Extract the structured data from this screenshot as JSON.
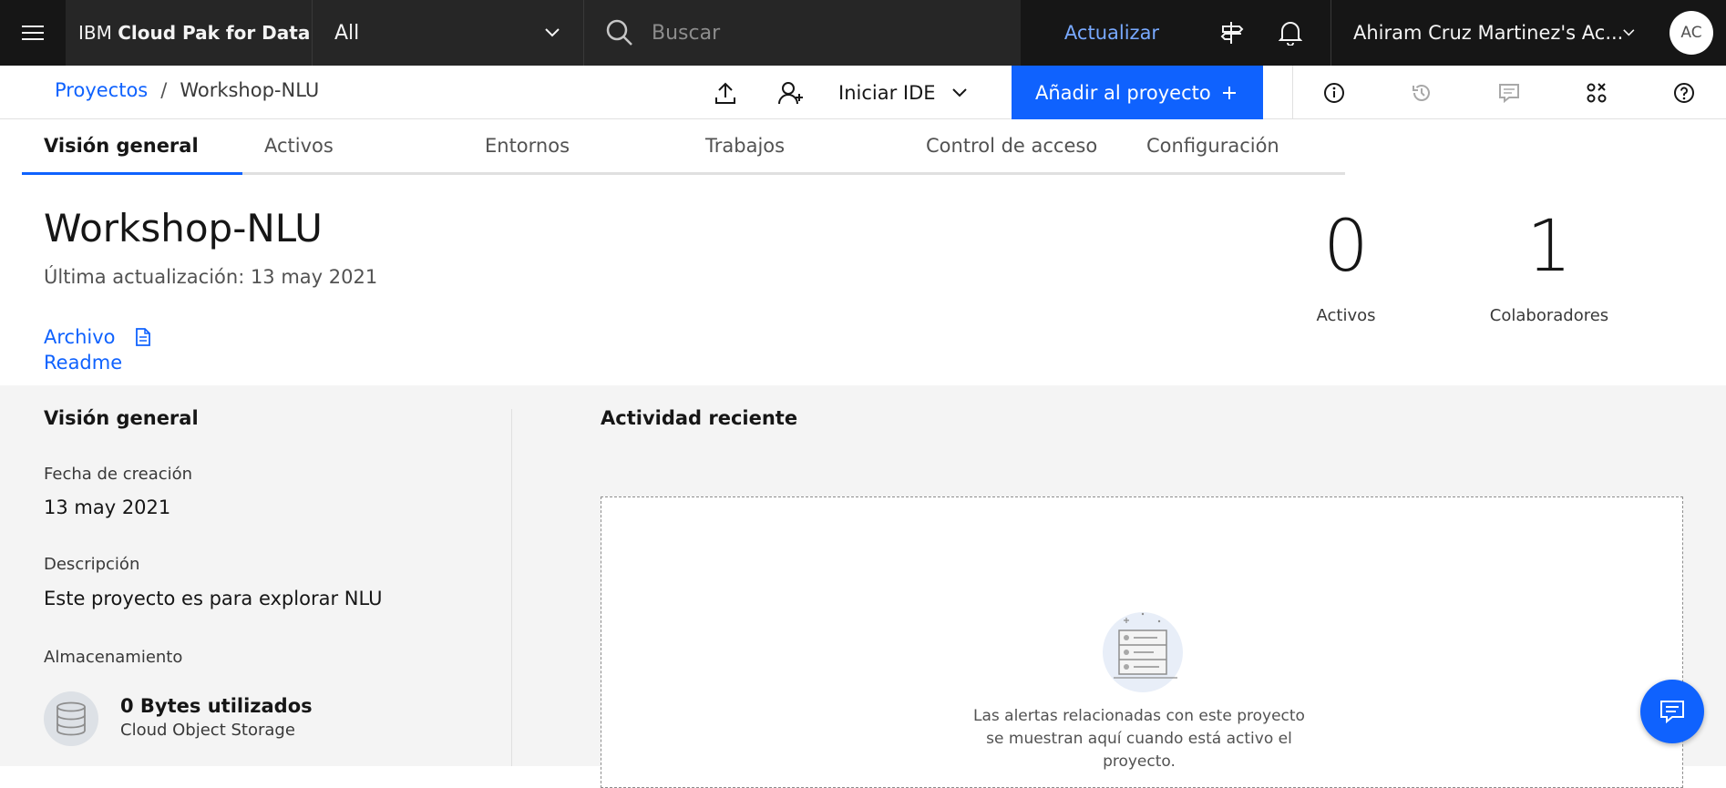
{
  "header": {
    "brand_prefix": "IBM",
    "brand_name": "Cloud Pak for Data",
    "scope_selected": "All",
    "search_placeholder": "Buscar",
    "upgrade_label": "Actualizar",
    "account_name": "Ahiram Cruz Martinez's Ac...",
    "avatar_initials": "AC"
  },
  "breadcrumb": {
    "parent": "Proyectos",
    "separator": "/",
    "current": "Workshop-NLU"
  },
  "toolbar": {
    "ide_label": "Iniciar IDE",
    "add_label": "Añadir al proyecto"
  },
  "tabs": [
    {
      "label": "Visión general",
      "active": true
    },
    {
      "label": "Activos",
      "active": false
    },
    {
      "label": "Entornos",
      "active": false
    },
    {
      "label": "Trabajos",
      "active": false
    },
    {
      "label": "Control de acceso",
      "active": false
    },
    {
      "label": "Configuración",
      "active": false
    }
  ],
  "project": {
    "title": "Workshop-NLU",
    "updated": "Última actualización: 13 may 2021",
    "file_label": "Archivo",
    "readme_label": "Readme"
  },
  "stats": {
    "assets_count": "0",
    "assets_label": "Activos",
    "collaborators_count": "1",
    "collaborators_label": "Colaboradores"
  },
  "overview": {
    "heading": "Visión general",
    "created_label": "Fecha de creación",
    "created_value": "13 may 2021",
    "description_label": "Descripción",
    "description_value": "Este proyecto es para explorar NLU",
    "storage_label": "Almacenamiento",
    "storage_used": "0 Bytes utilizados",
    "storage_type": "Cloud Object Storage"
  },
  "activity": {
    "heading": "Actividad reciente",
    "empty_line1": "Las alertas relacionadas con este proyecto",
    "empty_line2": "se muestran aquí cuando está activo el",
    "empty_line3": "proyecto."
  },
  "colors": {
    "topbar": "#161616",
    "accent": "#0f62fe",
    "link": "#0f62fe",
    "upgrade": "#78a9ff",
    "panel": "#f4f4f4"
  }
}
